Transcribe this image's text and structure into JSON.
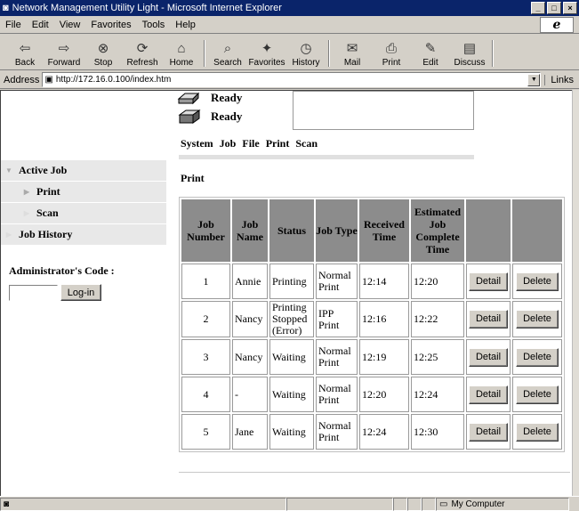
{
  "window": {
    "title": "Network Management Utility Light - Microsoft Internet Explorer",
    "controls": [
      "_",
      "□",
      "×"
    ]
  },
  "menu": [
    "File",
    "Edit",
    "View",
    "Favorites",
    "Tools",
    "Help"
  ],
  "toolbar": [
    {
      "label": "Back",
      "icon": "back-arrow-icon",
      "glyph": "⇦"
    },
    {
      "label": "Forward",
      "icon": "forward-arrow-icon",
      "glyph": "⇨"
    },
    {
      "label": "Stop",
      "icon": "stop-icon",
      "glyph": "⊗"
    },
    {
      "label": "Refresh",
      "icon": "refresh-icon",
      "glyph": "⟳"
    },
    {
      "label": "Home",
      "icon": "home-icon",
      "glyph": "⌂"
    },
    {
      "label": "Search",
      "icon": "search-icon",
      "glyph": "⌕"
    },
    {
      "label": "Favorites",
      "icon": "favorites-icon",
      "glyph": "✦"
    },
    {
      "label": "History",
      "icon": "history-icon",
      "glyph": "◷"
    },
    {
      "label": "Mail",
      "icon": "mail-icon",
      "glyph": "✉"
    },
    {
      "label": "Print",
      "icon": "print-icon",
      "glyph": "⎙"
    },
    {
      "label": "Edit",
      "icon": "edit-icon",
      "glyph": "✎"
    },
    {
      "label": "Discuss",
      "icon": "discuss-icon",
      "glyph": "▤"
    }
  ],
  "address": {
    "label": "Address",
    "url": "http://172.16.0.100/index.htm",
    "links_label": "Links"
  },
  "status_bar": {
    "zone": "My Computer"
  },
  "device": {
    "status_lines": [
      "Ready",
      "Ready"
    ]
  },
  "tabs": [
    "System",
    "Job",
    "File",
    "Print",
    "Scan"
  ],
  "sidebar": {
    "items": [
      {
        "label": "Active Job",
        "level": 1
      },
      {
        "label": "Print",
        "level": 2
      },
      {
        "label": "Scan",
        "level": 2
      },
      {
        "label": "Job History",
        "level": 1
      }
    ],
    "admin_label": "Administrator's Code :",
    "login_button": "Log-in"
  },
  "section_title": "Print",
  "table": {
    "headers": [
      "Job Number",
      "Job Name",
      "Status",
      "Job Type",
      "Received Time",
      "Estimated Job Complete Time",
      "",
      ""
    ],
    "rows": [
      {
        "number": "1",
        "name": "Annie",
        "status": "Printing",
        "type": "Normal Print",
        "received": "12:14",
        "complete": "12:20"
      },
      {
        "number": "2",
        "name": "Nancy",
        "status": "Printing Stopped (Error)",
        "type": "IPP Print",
        "received": "12:16",
        "complete": "12:22"
      },
      {
        "number": "3",
        "name": "Nancy",
        "status": "Waiting",
        "type": "Normal Print",
        "received": "12:19",
        "complete": "12:25"
      },
      {
        "number": "4",
        "name": "-",
        "status": "Waiting",
        "type": "Normal Print",
        "received": "12:20",
        "complete": "12:24"
      },
      {
        "number": "5",
        "name": "Jane",
        "status": "Waiting",
        "type": "Normal Print",
        "received": "12:24",
        "complete": "12:30"
      }
    ],
    "detail_label": "Detail",
    "delete_label": "Delete"
  }
}
